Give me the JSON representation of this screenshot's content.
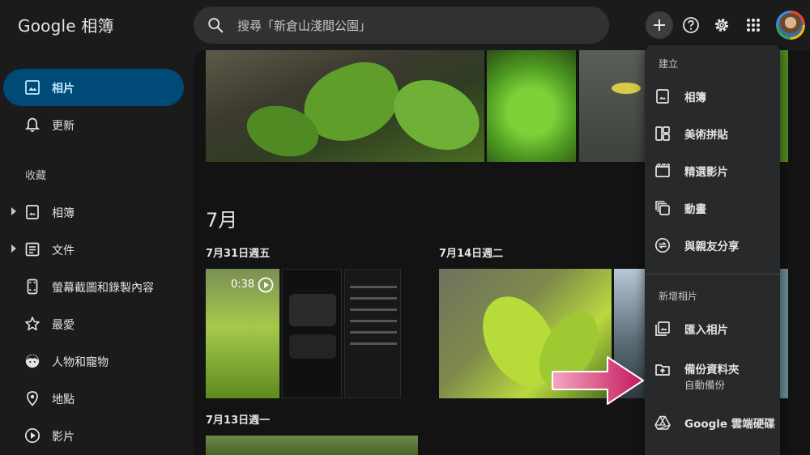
{
  "header": {
    "logo_text": "Google 相簿",
    "search_text": "搜尋「新倉山淺間公園」"
  },
  "sidebar": {
    "items": [
      {
        "label": "相片",
        "icon": "photo-icon",
        "active": true
      },
      {
        "label": "更新",
        "icon": "bell-icon"
      }
    ],
    "section_label": "收藏",
    "collection_items": [
      {
        "label": "相簿",
        "icon": "album-icon"
      },
      {
        "label": "文件",
        "icon": "document-icon"
      },
      {
        "label": "螢幕截圖和錄製內容",
        "icon": "phone-screenshot-icon"
      },
      {
        "label": "最愛",
        "icon": "star-icon"
      },
      {
        "label": "人物和寵物",
        "icon": "face-icon"
      },
      {
        "label": "地點",
        "icon": "location-pin-icon"
      },
      {
        "label": "影片",
        "icon": "play-circle-icon"
      }
    ]
  },
  "main": {
    "month": "7月",
    "dates": [
      "7月31日週五",
      "7月14日週二",
      "7月13日週一"
    ],
    "video_duration": "0:38"
  },
  "menu": {
    "create_header": "建立",
    "create_items": [
      "相簿",
      "美術拼貼",
      "精選影片",
      "動畫",
      "與親友分享"
    ],
    "add_header": "新增相片",
    "add_items": [
      {
        "label": "匯入相片"
      },
      {
        "label": "備份資料夾",
        "sub": "自動備份"
      },
      {
        "label": "Google 雲端硬碟"
      }
    ]
  },
  "colors": {
    "accent": "#004a77",
    "arrow": "#c2185b"
  }
}
